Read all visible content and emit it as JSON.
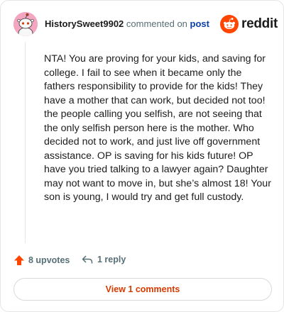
{
  "header": {
    "author": "HistorySweet9902",
    "commented_text": "commented on",
    "post_link": "post"
  },
  "brand": {
    "wordmark": "reddit",
    "icon": "reddit-alien-icon",
    "color": "#ff4500"
  },
  "comment": {
    "body": "NTA! You are proving for your kids, and saving for college. I fail to see when it became only the fathers responsibility to provide for the kids! They have a mother that can work, but decided not too! the people calling you selfish, are not seeing that the only selfish person here is the mother. Who decided not to work, and just live off government assistance. OP is saving for his kids future! OP have you tried talking to a lawyer again? Daughter may not want to move in, but she’s almost 18! Your son is young, I would try and get full custody."
  },
  "actions": {
    "upvotes_label": "8 upvotes",
    "upvote_icon": "upvote-arrow-icon",
    "reply_label": "1 reply",
    "reply_icon": "reply-arrow-icon",
    "view_comments_label": "View 1 comments"
  },
  "colors": {
    "accent": "#ff4500",
    "link": "#0a3fa8",
    "muted": "#576f76",
    "avatar_bg": "#f4a6c0"
  }
}
